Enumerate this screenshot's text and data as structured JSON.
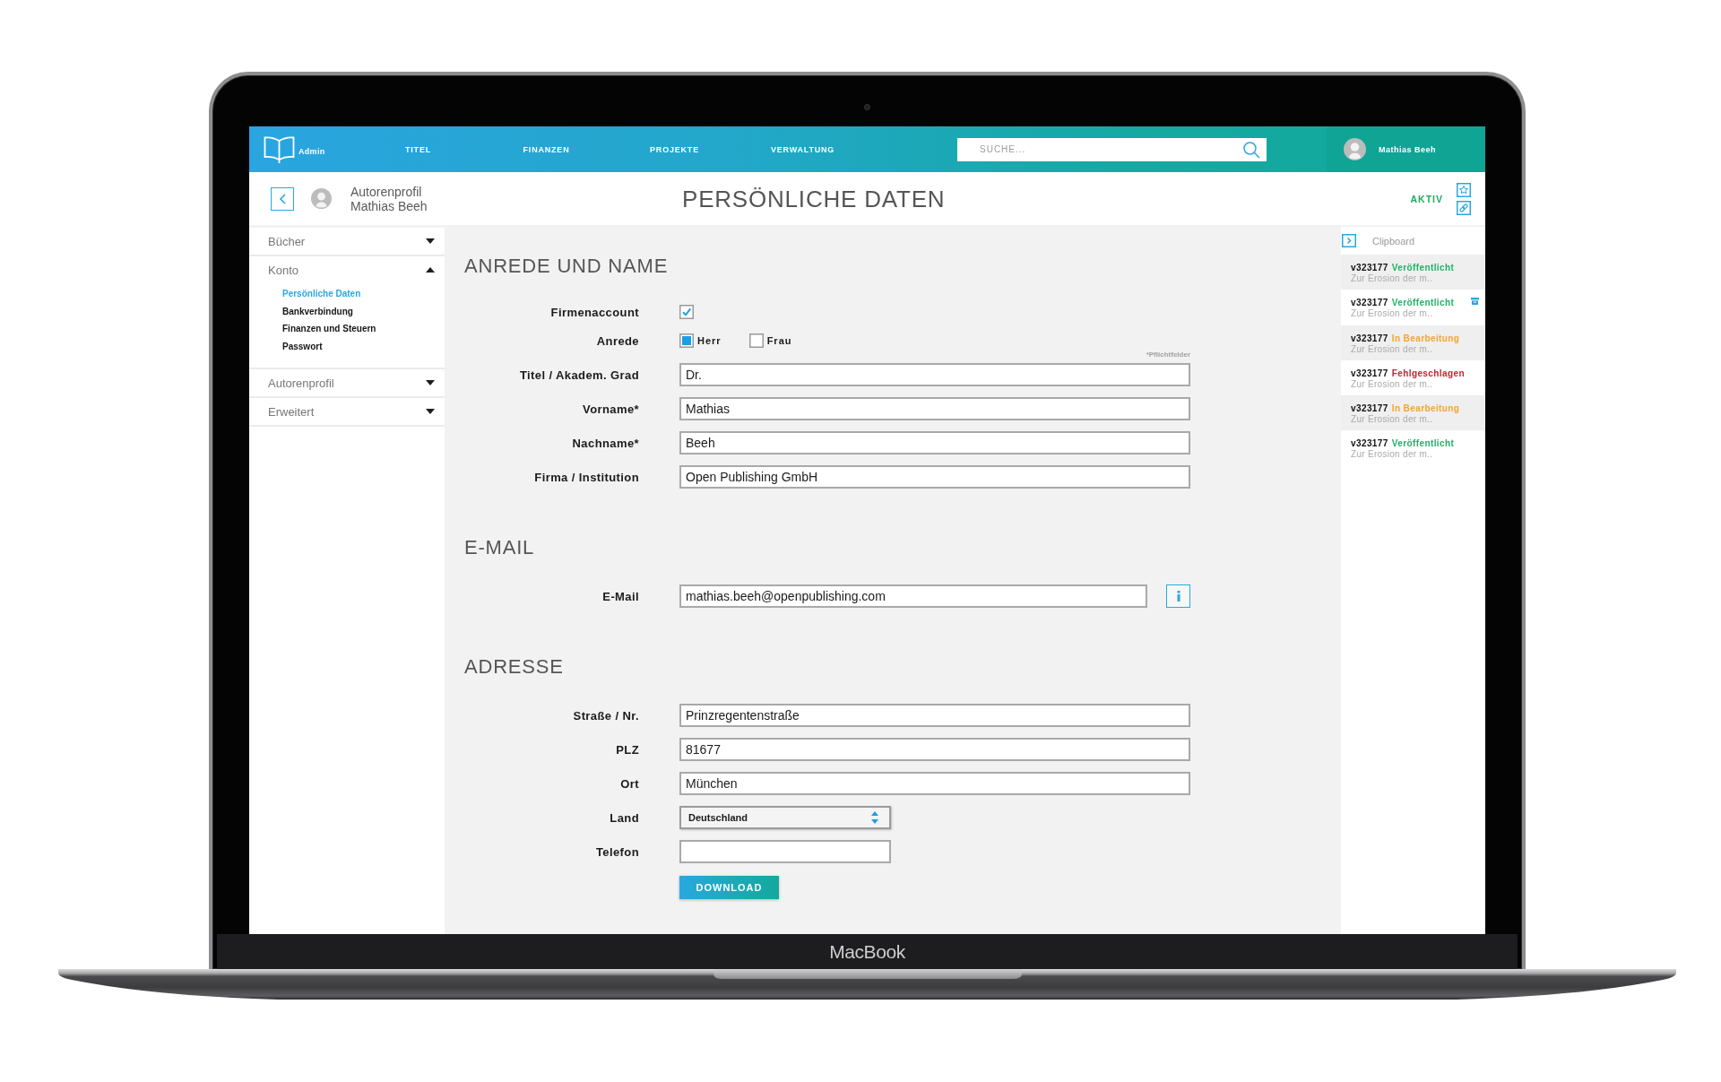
{
  "device": {
    "label": "MacBook"
  },
  "header": {
    "logo_text": "Admin",
    "nav": [
      {
        "label": "TITEL"
      },
      {
        "label": "FINANZEN"
      },
      {
        "label": "PROJEKTE"
      },
      {
        "label": "VERWALTUNG"
      }
    ],
    "search": {
      "placeholder": "SUCHE..."
    },
    "user": {
      "name": "Mathias Beeh"
    }
  },
  "subheader": {
    "section": "Autorenprofil",
    "name": "Mathias Beeh",
    "title": "PERSÖNLICHE DATEN",
    "status": "AKTIV"
  },
  "sidebar": {
    "sections": [
      {
        "label": "Bücher",
        "expanded": false
      },
      {
        "label": "Konto",
        "expanded": true,
        "children": [
          {
            "label": "Persönliche Daten",
            "selected": true
          },
          {
            "label": "Bankverbindung",
            "selected": false
          },
          {
            "label": "Finanzen und Steuern",
            "selected": false
          },
          {
            "label": "Passwort",
            "selected": false
          }
        ]
      },
      {
        "label": "Autorenprofil",
        "expanded": false
      },
      {
        "label": "Erweitert",
        "expanded": false
      }
    ]
  },
  "form": {
    "sections": [
      {
        "title": "ANREDE UND NAME",
        "fields": [
          {
            "kind": "checkbox",
            "label": "Firmenaccount",
            "checked": true
          },
          {
            "kind": "radio",
            "label": "Anrede",
            "options": [
              {
                "label": "Herr",
                "selected": true
              },
              {
                "label": "Frau",
                "selected": false
              }
            ]
          },
          {
            "kind": "note",
            "text": "*Pflichtfelder"
          },
          {
            "kind": "text",
            "label": "Titel / Akadem. Grad",
            "value": "Dr."
          },
          {
            "kind": "text",
            "label": "Vorname*",
            "value": "Mathias"
          },
          {
            "kind": "text",
            "label": "Nachname*",
            "value": "Beeh"
          },
          {
            "kind": "text",
            "label": "Firma / Institution",
            "value": "Open Publishing GmbH"
          }
        ]
      },
      {
        "title": "E-MAIL",
        "fields": [
          {
            "kind": "email",
            "label": "E-Mail",
            "value": "mathias.beeh@openpublishing.com",
            "info": true
          }
        ]
      },
      {
        "title": "ADRESSE",
        "fields": [
          {
            "kind": "text",
            "label": "Straße / Nr.",
            "value": "Prinzregentenstraße"
          },
          {
            "kind": "text",
            "label": "PLZ",
            "value": "81677"
          },
          {
            "kind": "text",
            "label": "Ort",
            "value": "München"
          },
          {
            "kind": "select",
            "label": "Land",
            "value": "Deutschland"
          },
          {
            "kind": "phone",
            "label": "Telefon"
          }
        ]
      }
    ],
    "button": "DOWNLOAD"
  },
  "clipboard": {
    "title": "Clipboard",
    "items": [
      {
        "code": "v323177",
        "status": "Veröffentlicht",
        "color": "#20b168",
        "excerpt": "Zur Erosion der m..",
        "action_icon": false
      },
      {
        "code": "v323177",
        "status": "Veröffentlicht",
        "color": "#20b168",
        "excerpt": "Zur Erosion der m..",
        "action_icon": true
      },
      {
        "code": "v323177",
        "status": "In Bearbeitung",
        "color": "#f6a42c",
        "excerpt": "Zur Erosion der m..",
        "action_icon": false
      },
      {
        "code": "v323177",
        "status": "Fehlgeschlagen",
        "color": "#cc2131",
        "excerpt": "Zur Erosion der m..",
        "action_icon": false
      },
      {
        "code": "v323177",
        "status": "In Bearbeitung",
        "color": "#f6a42c",
        "excerpt": "Zur Erosion der m..",
        "action_icon": false
      },
      {
        "code": "v323177",
        "status": "Veröffentlicht",
        "color": "#20b168",
        "excerpt": "Zur Erosion der m..",
        "action_icon": false
      }
    ]
  }
}
